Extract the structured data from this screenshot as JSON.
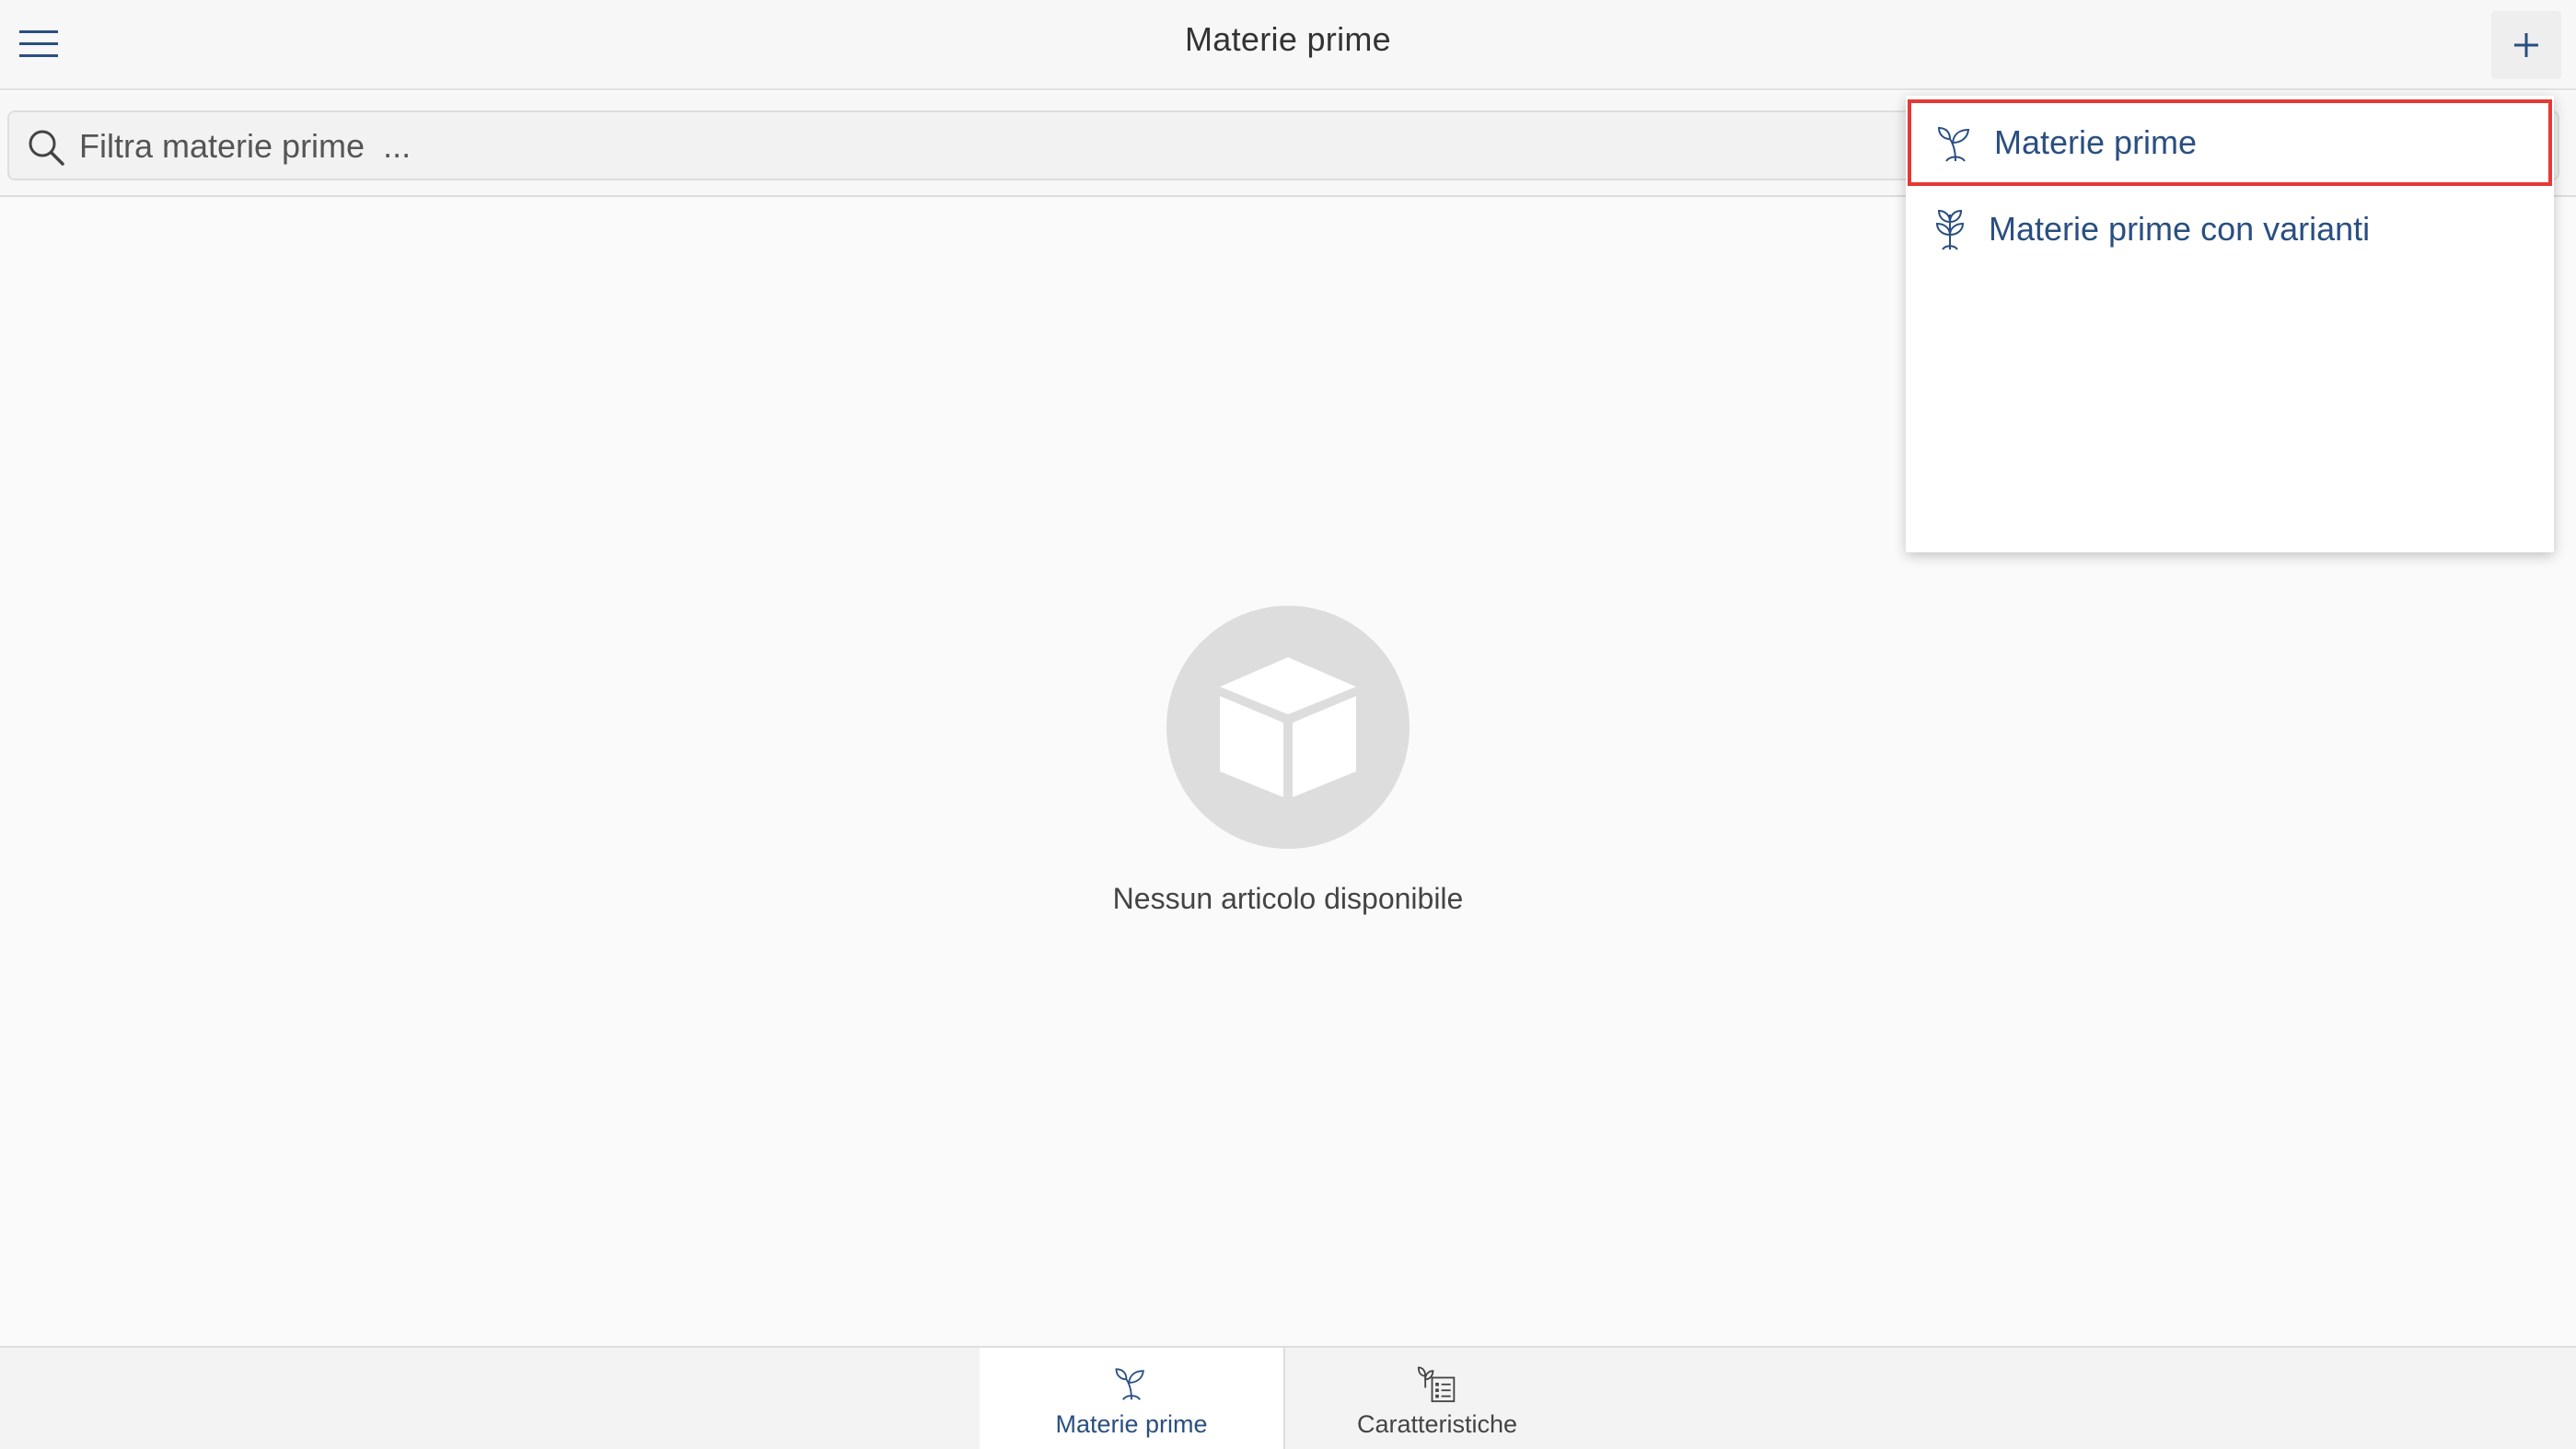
{
  "header": {
    "title": "Materie prime",
    "menu_icon": "hamburger-menu-icon",
    "add_icon": "plus-icon"
  },
  "search": {
    "placeholder": "Filtra materie prime  ...",
    "value": "",
    "icon": "search-icon"
  },
  "empty_state": {
    "icon": "box-icon",
    "text": "Nessun articolo disponibile"
  },
  "dropdown": {
    "items": [
      {
        "label": "Materie prime",
        "icon": "sprout-icon",
        "highlighted": true
      },
      {
        "label": "Materie prime con varianti",
        "icon": "plant-variants-icon",
        "highlighted": false
      }
    ],
    "highlight_color": "#e53935"
  },
  "tabs": [
    {
      "label": "Materie prime",
      "icon": "sprout-icon",
      "active": true
    },
    {
      "label": "Caratteristiche",
      "icon": "plant-list-icon",
      "active": false
    }
  ],
  "colors": {
    "accent": "#2a4f80",
    "background": "#fafafa"
  }
}
